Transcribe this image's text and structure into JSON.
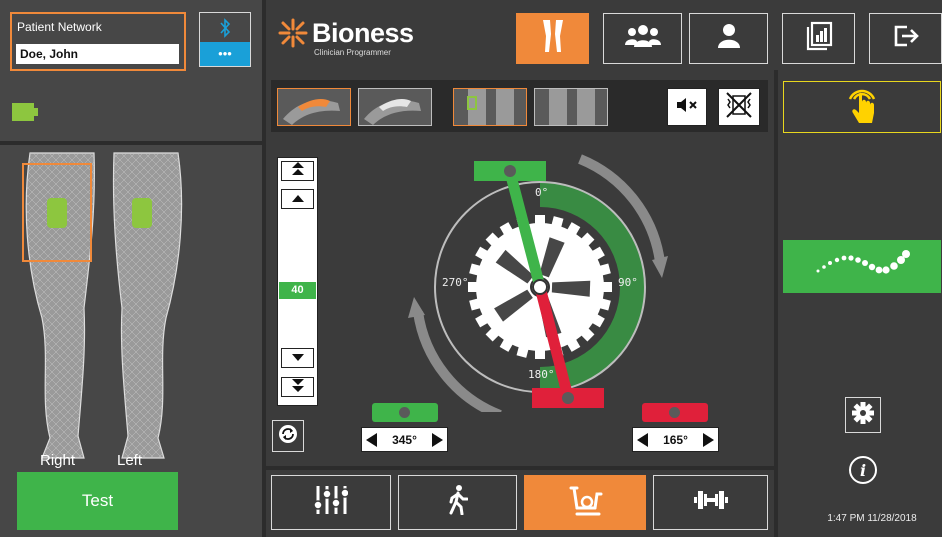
{
  "patient": {
    "label": "Patient Network",
    "name": "Doe, John"
  },
  "bluetooth": {
    "icon": "bluetooth-icon",
    "dots": "•••"
  },
  "battery": {
    "icon": "battery-icon",
    "color": "#8dc63f"
  },
  "brand": {
    "name": "Bioness",
    "tagline": "Clinician Programmer",
    "logo_color": "#f0893a"
  },
  "nav": [
    {
      "name": "legs-nav-button",
      "icon": "legs-icon",
      "active": true
    },
    {
      "name": "group-nav-button",
      "icon": "group-icon",
      "active": false
    },
    {
      "name": "patient-nav-button",
      "icon": "person-icon",
      "active": false
    },
    {
      "name": "reports-nav-button",
      "icon": "report-icon",
      "active": false
    },
    {
      "name": "exit-nav-button",
      "icon": "exit-icon",
      "active": false
    }
  ],
  "legs": {
    "right_label": "Right",
    "left_label": "Left",
    "test_label": "Test"
  },
  "intensity": {
    "value": "40"
  },
  "cycle": {
    "angle_0": "0°",
    "angle_90": "90°",
    "angle_180": "180°",
    "angle_270": "270°",
    "start_value": "345°",
    "end_value": "165°"
  },
  "modes": [
    {
      "name": "settings-mode-button",
      "icon": "sliders-icon",
      "active": false
    },
    {
      "name": "walk-mode-button",
      "icon": "walking-icon",
      "active": false
    },
    {
      "name": "bike-mode-button",
      "icon": "bike-icon",
      "active": true
    },
    {
      "name": "strength-mode-button",
      "icon": "dumbbell-icon",
      "active": false
    }
  ],
  "status": {
    "timestamp": "1:47 PM 11/28/2018"
  },
  "colors": {
    "accent": "#f0893a",
    "green": "#3fb44a",
    "red": "#e0203a",
    "bt_blue": "#1aa0d8"
  }
}
